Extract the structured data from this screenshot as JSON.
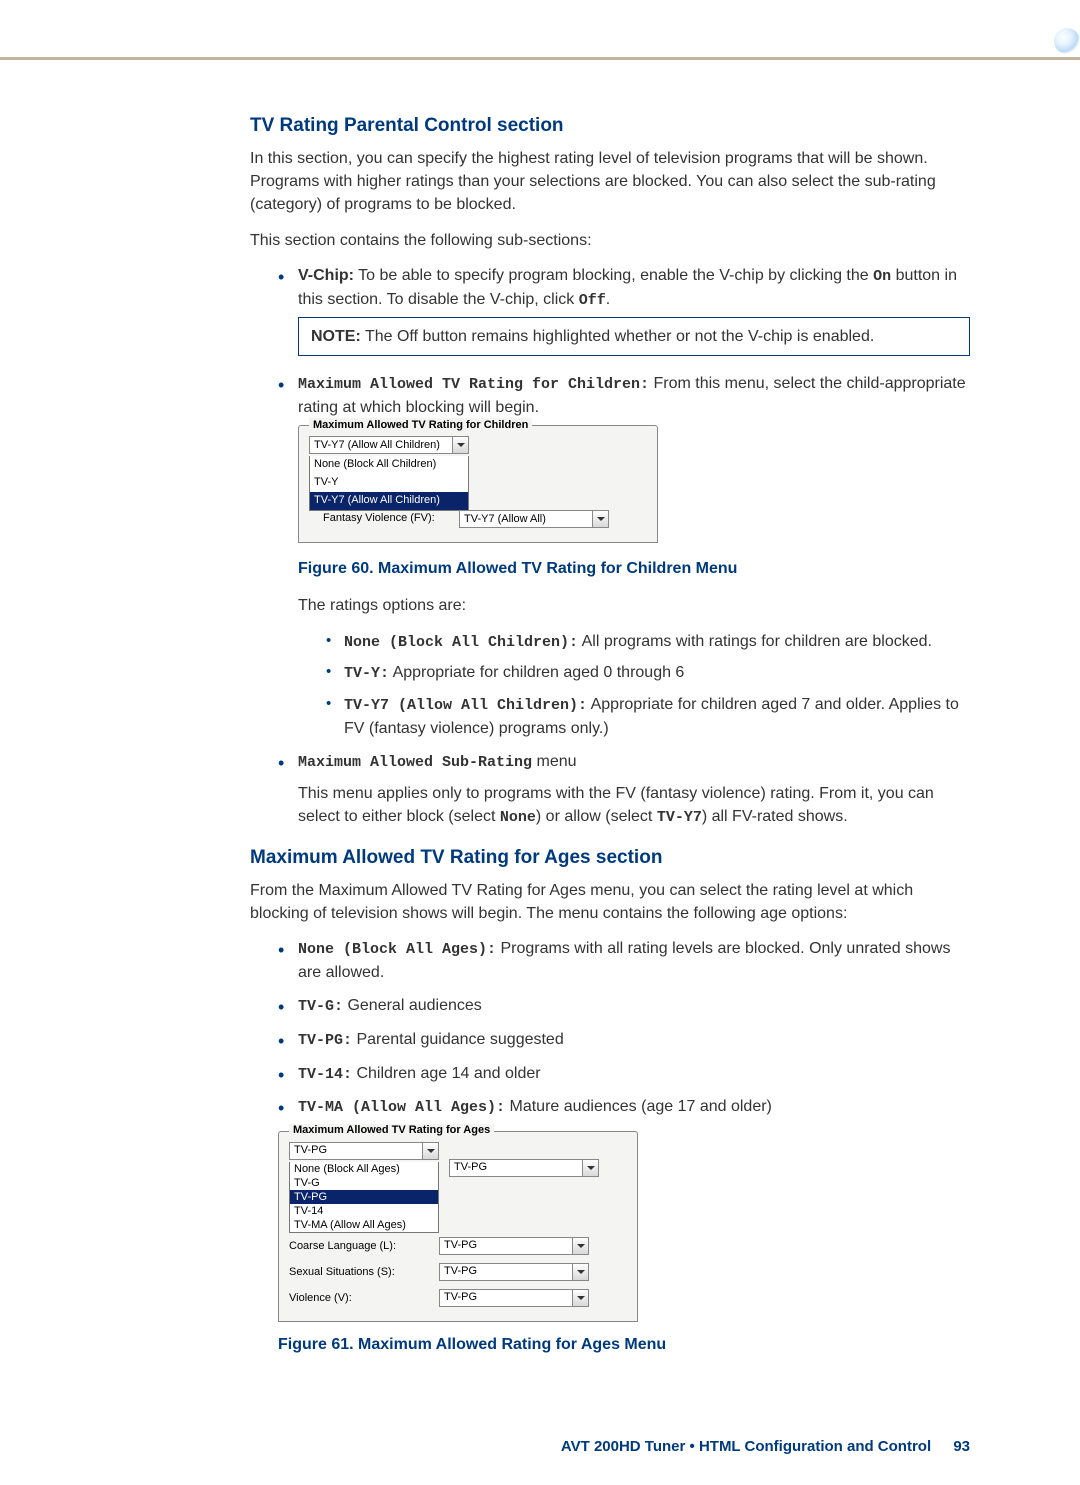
{
  "section1": {
    "heading": "TV Rating Parental Control section",
    "intro1": "In this section, you can specify the highest rating level of television programs that will be shown. Programs with higher ratings than your selections are blocked. You can also select the sub-rating (category) of programs to be blocked.",
    "intro2": "This section contains the following sub-sections:",
    "bullet_vchip_label": "V-Chip:",
    "bullet_vchip_text1": " To be able to specify program blocking, enable the V-chip by clicking the ",
    "on_code": "On",
    "bullet_vchip_text2": " button in this section. To disable the V-chip, click ",
    "off_code": "Off",
    "period": ".",
    "note_label": "NOTE:",
    "note_text": "   The Off button remains highlighted whether or not the V-chip is enabled.",
    "bullet_max_child_label": "Maximum Allowed TV Rating for Children:",
    "bullet_max_child_text": " From this menu, select the child-appropriate rating at which blocking will begin.",
    "fig60_caption": "Figure 60.  Maximum Allowed TV Rating for Children Menu",
    "ratings_intro": "The ratings options are:",
    "opt_none_label": "None (Block All Children):",
    "opt_none_text": " All programs with ratings for children are blocked.",
    "opt_tvy_label": "TV-Y:",
    "opt_tvy_text": "  Appropriate for children aged 0 through 6",
    "opt_tvy7_label": "TV-Y7 (Allow All Children):",
    "opt_tvy7_text": " Appropriate for children aged 7 and older. Applies to FV (fantasy violence)  programs only.)",
    "bullet_maxsub_label": "Maximum Allowed Sub-Rating",
    "bullet_maxsub_suffix": " menu",
    "maxsub_text1": "This menu applies only to programs with the FV (fantasy violence) rating. From it, you can select to either block (select ",
    "maxsub_none": "None",
    "maxsub_text2": ") or allow (select ",
    "maxsub_tvy7": "TV-Y7",
    "maxsub_text3": ") all FV-rated shows."
  },
  "fig60": {
    "legend": "Maximum Allowed TV Rating for Children",
    "sel_value": "TV-Y7 (Allow All Children)",
    "opts": [
      "None (Block All Children)",
      "TV-Y",
      "TV-Y7 (Allow All Children)"
    ],
    "sel_index": 2,
    "row_label": "Fantasy Violence (FV):",
    "row_value": "TV-Y7 (Allow All)"
  },
  "section2": {
    "heading": "Maximum Allowed TV Rating for Ages section",
    "intro": "From the Maximum Allowed TV Rating for Ages menu, you can select the rating level at which blocking of television shows will begin. The menu contains the following age options:",
    "b1_label": "None (Block All Ages):",
    "b1_text": " Programs with all rating levels are blocked. Only unrated shows are allowed.",
    "b2_label": "TV-G:",
    "b2_text": " General audiences",
    "b3_label": "TV-PG:",
    "b3_text": " Parental guidance suggested",
    "b4_label": "TV-14:",
    "b4_text": " Children age 14 and older",
    "b5_label": "TV-MA (Allow All Ages):",
    "b5_text": " Mature audiences (age 17 and older)",
    "fig61_caption": "Figure 61. Maximum Allowed Rating for Ages Menu"
  },
  "fig61": {
    "legend": "Maximum Allowed TV Rating for Ages",
    "sel_value": "TV-PG",
    "opts": [
      "None (Block All Ages)",
      "TV-G",
      "TV-PG",
      "TV-14",
      "TV-MA (Allow All Ages)"
    ],
    "sel_index": 2,
    "rows": [
      {
        "label": "Coarse Language (L):",
        "value": "TV-PG"
      },
      {
        "label": "Sexual Situations (S):",
        "value": "TV-PG"
      },
      {
        "label": "Violence (V):",
        "value": "TV-PG"
      }
    ],
    "hidden_row_value": "TV-PG"
  },
  "footer": {
    "text": "AVT 200HD Tuner • HTML Configuration and Control",
    "page": "93"
  }
}
